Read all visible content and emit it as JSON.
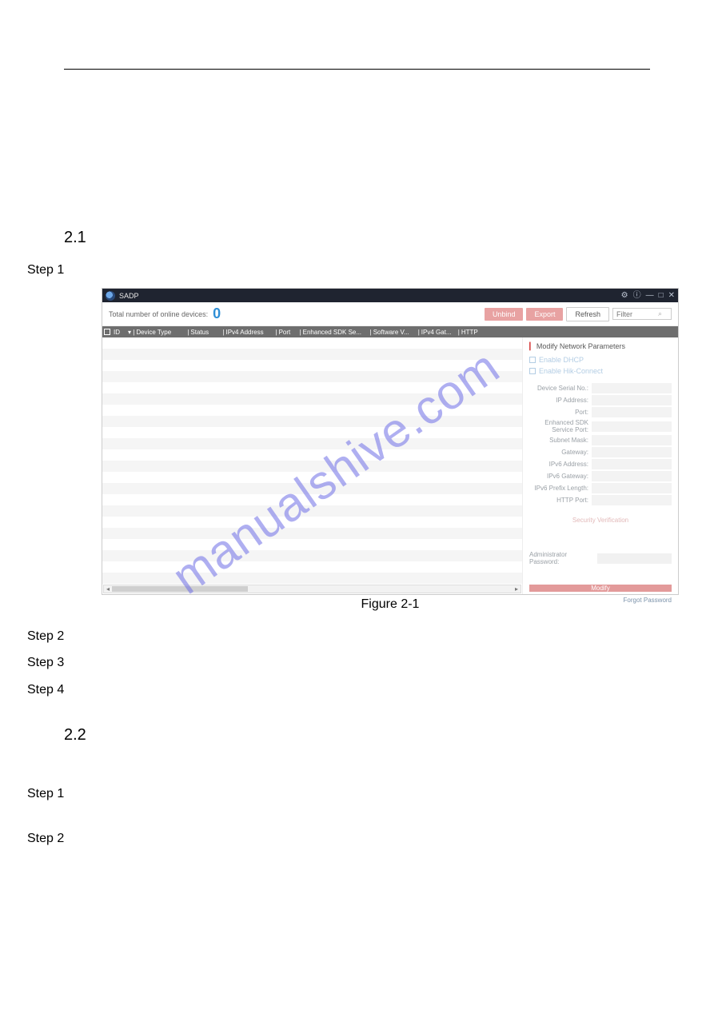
{
  "doc": {
    "section21_no": "2.1",
    "step1": "Step 1",
    "figure_caption": "Figure 2-1",
    "step2": "Step 2",
    "step3": "Step 3",
    "step4": "Step 4",
    "section22_no": "2.2",
    "b_step1": "Step 1",
    "b_step2": "Step 2"
  },
  "app": {
    "title": "SADP",
    "toolbar": {
      "total_label": "Total number of online devices:",
      "total_count": "0",
      "unbind": "Unbind",
      "export": "Export",
      "refresh": "Refresh",
      "filter_placeholder": "Filter"
    },
    "columns": {
      "id": "ID",
      "device_type": "Device Type",
      "status": "Status",
      "ipv4_addr": "IPv4 Address",
      "port": "Port",
      "enh_sdk": "Enhanced SDK Se...",
      "software": "Software V...",
      "ipv4_gate": "IPv4 Gat...",
      "http": "HTTP"
    },
    "panel": {
      "header": "Modify Network Parameters",
      "enable_dhcp": "Enable DHCP",
      "enable_hik": "Enable Hik-Connect",
      "fields": {
        "serial": "Device Serial No.:",
        "ip": "IP Address:",
        "port": "Port:",
        "enh_sdk_port": "Enhanced SDK Service Port:",
        "subnet": "Subnet Mask:",
        "gateway": "Gateway:",
        "ipv6_addr": "IPv6 Address:",
        "ipv6_gate": "IPv6 Gateway:",
        "ipv6_prefix": "IPv6 Prefix Length:",
        "http_port": "HTTP Port:"
      },
      "security_verification": "Security Verification",
      "admin_password": "Administrator Password:",
      "modify": "Modify",
      "forgot": "Forgot Password"
    }
  },
  "watermark": "manualshive.com"
}
